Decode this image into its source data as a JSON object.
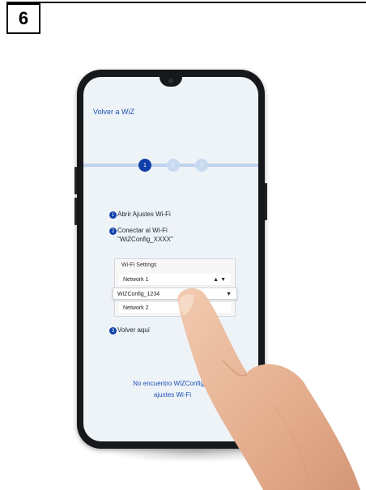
{
  "step_number": "6",
  "screen": {
    "back_link": "Volver a WiZ",
    "progress_steps": [
      "1",
      "2",
      "3"
    ],
    "instructions": [
      {
        "num": "1",
        "text": "Abrir Ajustes Wi-Fi"
      },
      {
        "num": "2",
        "text": "Conectar al Wi-Fi",
        "text2": "\"WiZConfig_XXXX\""
      },
      {
        "num": "3",
        "text": "Volver aquí"
      }
    ],
    "wifi_settings": {
      "title": "Wi-Fi Settings",
      "networks": [
        "Network 1",
        "WiZConfig_1234",
        "Network 2"
      ]
    },
    "help_line1": "No encuentro WiZConfig_X",
    "help_line2": "ajustes Wi-Fi"
  },
  "colors": {
    "accent": "#0f3fa8",
    "link": "#1c4fb3",
    "track": "#bed3ee"
  },
  "icons": [
    "lock-icon",
    "wifi-icon"
  ]
}
